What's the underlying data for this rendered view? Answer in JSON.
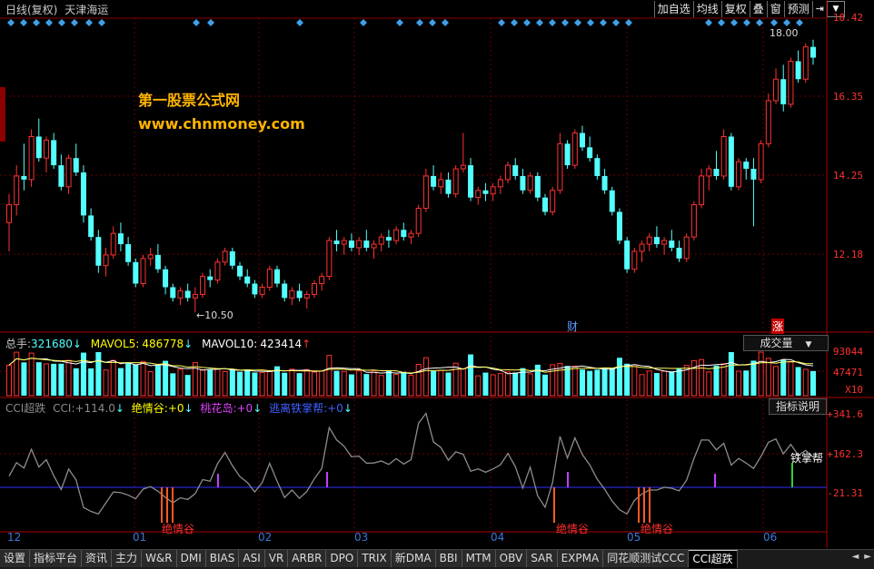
{
  "window": {
    "title": "日线(复权)",
    "stock_name": "天津海运"
  },
  "toolbar": [
    {
      "label": "加自选"
    },
    {
      "label": "均线"
    },
    {
      "label": "复权"
    },
    {
      "label": "叠"
    },
    {
      "label": "窗"
    },
    {
      "label": "预测"
    },
    {
      "label": "⇥"
    }
  ],
  "price_axis": [
    "18.42",
    "16.35",
    "14.25",
    "12.18"
  ],
  "price_annotations": {
    "high": "18.00",
    "low": "10.50"
  },
  "event_marks": {
    "cai": "财",
    "zhang": "涨"
  },
  "watermark": {
    "line1": "第一股票公式网",
    "line2": "www.chnmoney.com"
  },
  "volume_panel": {
    "label_total": "总手:",
    "total": "321680",
    "ma5_label": "MAVOL5:",
    "ma5": "486778",
    "ma10_label": "MAVOL10:",
    "ma10": "423414",
    "selector": "成交量",
    "axis": [
      "93044",
      "47471"
    ],
    "unit": "X10"
  },
  "indicator_panel": {
    "name": "CCI超跌",
    "cci_label": "CCI:",
    "cci": "+114.0",
    "jqg_label": "绝情谷:",
    "jqg": "+0",
    "thd_label": "桃花岛:",
    "thd": "+0",
    "ttz_label": "逃离铁掌帮:",
    "ttz": "+0",
    "help_button": "指标说明",
    "axis": [
      "+341.6",
      "+162.3",
      "-21.31"
    ],
    "annotations": {
      "tiezhang": "铁掌帮",
      "jueqing": "绝情谷",
      "jueqing2": "绝情谷"
    }
  },
  "x_axis": [
    "12",
    "01",
    "02",
    "03",
    "04",
    "05",
    "06"
  ],
  "tabs": [
    "设置",
    "指标平台",
    "资讯",
    "主力",
    "W&R",
    "DMI",
    "BIAS",
    "ASI",
    "VR",
    "ARBR",
    "DPO",
    "TRIX",
    "新DMA",
    "BBI",
    "MTM",
    "OBV",
    "SAR",
    "EXPMA",
    "同花顺测试CCC",
    "CCI超跌"
  ],
  "colors": {
    "up": "#ff3232",
    "down": "#54ffff",
    "bg": "#000000",
    "indicator_line": "#8c8c8c",
    "baseline": "#3030ff",
    "marker": "#c040ff"
  },
  "chart_data": {
    "type": "candlestick",
    "price_range": [
      10.5,
      18.42
    ],
    "series_note": "",
    "candles": [
      [
        13.0,
        13.8,
        12.2,
        13.5
      ],
      [
        13.5,
        14.6,
        13.2,
        14.3
      ],
      [
        14.3,
        15.2,
        13.9,
        14.2
      ],
      [
        14.2,
        15.6,
        14.0,
        15.4
      ],
      [
        15.4,
        15.9,
        14.7,
        14.8
      ],
      [
        14.8,
        15.4,
        14.4,
        15.3
      ],
      [
        15.3,
        15.5,
        14.5,
        14.6
      ],
      [
        14.6,
        14.9,
        13.9,
        14.0
      ],
      [
        14.0,
        14.9,
        13.8,
        14.8
      ],
      [
        14.8,
        15.2,
        14.3,
        14.4
      ],
      [
        14.4,
        14.6,
        13.0,
        13.2
      ],
      [
        13.2,
        13.4,
        12.5,
        12.6
      ],
      [
        12.6,
        12.8,
        11.6,
        11.8
      ],
      [
        11.8,
        12.3,
        11.5,
        12.1
      ],
      [
        12.1,
        12.9,
        12.0,
        12.7
      ],
      [
        12.7,
        13.0,
        12.2,
        12.4
      ],
      [
        12.4,
        12.6,
        11.8,
        11.9
      ],
      [
        11.9,
        12.0,
        11.2,
        11.3
      ],
      [
        11.3,
        12.1,
        11.2,
        12.0
      ],
      [
        12.0,
        12.3,
        11.8,
        12.1
      ],
      [
        12.1,
        12.4,
        11.6,
        11.7
      ],
      [
        11.7,
        11.8,
        11.0,
        11.2
      ],
      [
        11.2,
        11.3,
        10.8,
        10.9
      ],
      [
        10.9,
        11.2,
        10.7,
        11.1
      ],
      [
        11.1,
        11.3,
        10.8,
        10.9
      ],
      [
        10.9,
        11.2,
        10.5,
        11.0
      ],
      [
        11.0,
        11.6,
        10.9,
        11.5
      ],
      [
        11.5,
        11.7,
        11.2,
        11.4
      ],
      [
        11.4,
        12.0,
        11.3,
        11.9
      ],
      [
        11.9,
        12.3,
        11.8,
        12.2
      ],
      [
        12.2,
        12.3,
        11.7,
        11.8
      ],
      [
        11.8,
        11.9,
        11.4,
        11.5
      ],
      [
        11.5,
        11.7,
        11.2,
        11.3
      ],
      [
        11.3,
        11.4,
        10.9,
        11.0
      ],
      [
        11.0,
        11.3,
        10.9,
        11.2
      ],
      [
        11.2,
        11.8,
        11.1,
        11.7
      ],
      [
        11.7,
        11.8,
        11.2,
        11.3
      ],
      [
        11.3,
        11.4,
        10.8,
        10.9
      ],
      [
        10.9,
        11.2,
        10.7,
        11.1
      ],
      [
        11.1,
        11.3,
        10.8,
        10.9
      ],
      [
        10.9,
        11.1,
        10.6,
        11.0
      ],
      [
        11.0,
        11.4,
        10.9,
        11.3
      ],
      [
        11.3,
        11.6,
        11.1,
        11.5
      ],
      [
        11.5,
        12.6,
        11.4,
        12.5
      ],
      [
        12.5,
        12.8,
        12.2,
        12.4
      ],
      [
        12.4,
        12.6,
        12.1,
        12.5
      ],
      [
        12.5,
        12.7,
        12.2,
        12.3
      ],
      [
        12.3,
        12.6,
        12.1,
        12.5
      ],
      [
        12.5,
        12.8,
        12.2,
        12.3
      ],
      [
        12.3,
        12.5,
        12.0,
        12.4
      ],
      [
        12.4,
        12.7,
        12.2,
        12.6
      ],
      [
        12.6,
        12.8,
        12.3,
        12.5
      ],
      [
        12.5,
        12.9,
        12.4,
        12.8
      ],
      [
        12.8,
        13.0,
        12.5,
        12.6
      ],
      [
        12.6,
        12.8,
        12.4,
        12.7
      ],
      [
        12.7,
        13.5,
        12.6,
        13.4
      ],
      [
        13.4,
        14.5,
        13.3,
        14.3
      ],
      [
        14.3,
        14.6,
        13.9,
        14.0
      ],
      [
        14.0,
        14.4,
        13.8,
        14.2
      ],
      [
        14.2,
        14.4,
        13.7,
        13.8
      ],
      [
        13.8,
        14.6,
        13.7,
        14.5
      ],
      [
        14.5,
        15.5,
        14.4,
        14.6
      ],
      [
        14.6,
        14.8,
        13.6,
        13.7
      ],
      [
        13.7,
        14.0,
        13.5,
        13.9
      ],
      [
        13.9,
        14.1,
        13.6,
        13.8
      ],
      [
        13.8,
        14.1,
        13.6,
        14.0
      ],
      [
        14.0,
        14.3,
        13.8,
        14.2
      ],
      [
        14.2,
        14.7,
        14.1,
        14.6
      ],
      [
        14.6,
        14.8,
        14.2,
        14.3
      ],
      [
        14.3,
        14.5,
        13.8,
        13.9
      ],
      [
        13.9,
        14.4,
        13.8,
        14.3
      ],
      [
        14.3,
        14.4,
        13.6,
        13.7
      ],
      [
        13.7,
        13.8,
        13.2,
        13.3
      ],
      [
        13.3,
        14.0,
        13.2,
        13.9
      ],
      [
        13.9,
        15.5,
        13.8,
        15.2
      ],
      [
        15.2,
        15.3,
        14.5,
        14.6
      ],
      [
        14.6,
        15.6,
        14.5,
        15.5
      ],
      [
        15.5,
        15.7,
        15.0,
        15.1
      ],
      [
        15.1,
        15.4,
        14.7,
        14.8
      ],
      [
        14.8,
        14.9,
        14.2,
        14.3
      ],
      [
        14.3,
        14.5,
        13.8,
        13.9
      ],
      [
        13.9,
        14.0,
        13.2,
        13.3
      ],
      [
        13.3,
        13.4,
        12.4,
        12.5
      ],
      [
        12.5,
        12.6,
        11.6,
        11.7
      ],
      [
        11.7,
        12.3,
        11.6,
        12.2
      ],
      [
        12.2,
        12.5,
        11.9,
        12.4
      ],
      [
        12.4,
        12.7,
        12.2,
        12.6
      ],
      [
        12.6,
        12.9,
        12.3,
        12.4
      ],
      [
        12.4,
        12.6,
        12.1,
        12.5
      ],
      [
        12.5,
        12.8,
        12.2,
        12.3
      ],
      [
        12.3,
        12.5,
        11.9,
        12.0
      ],
      [
        12.0,
        12.7,
        11.9,
        12.6
      ],
      [
        12.6,
        13.6,
        12.5,
        13.5
      ],
      [
        13.5,
        14.5,
        13.4,
        14.3
      ],
      [
        14.3,
        14.6,
        13.9,
        14.5
      ],
      [
        14.5,
        15.0,
        14.2,
        14.3
      ],
      [
        14.3,
        15.6,
        14.2,
        15.4
      ],
      [
        15.4,
        15.5,
        13.9,
        14.0
      ],
      [
        14.0,
        14.8,
        13.9,
        14.7
      ],
      [
        14.7,
        14.8,
        14.2,
        14.5
      ],
      [
        14.5,
        14.8,
        12.9,
        14.2
      ],
      [
        14.2,
        15.3,
        14.1,
        15.2
      ],
      [
        15.2,
        16.6,
        15.1,
        16.4
      ],
      [
        16.4,
        17.3,
        16.3,
        17.0
      ],
      [
        17.0,
        17.4,
        16.1,
        16.3
      ],
      [
        16.3,
        17.6,
        16.2,
        17.5
      ],
      [
        17.5,
        17.8,
        16.9,
        17.0
      ],
      [
        17.0,
        18.0,
        16.9,
        17.9
      ],
      [
        17.9,
        18.1,
        17.4,
        17.6
      ]
    ]
  }
}
